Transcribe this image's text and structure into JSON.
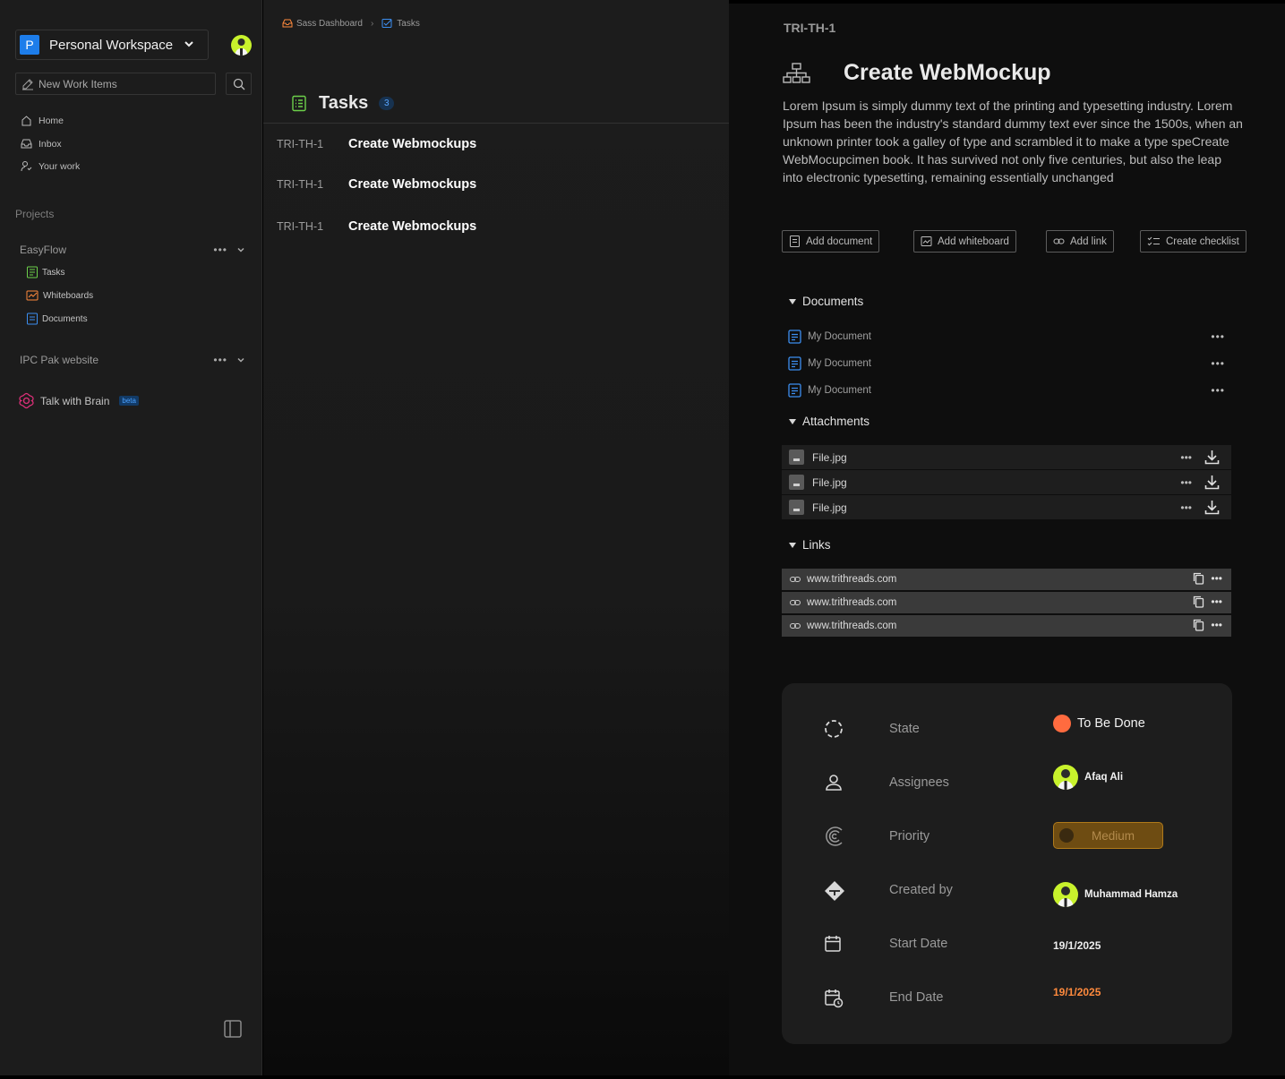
{
  "sidebar": {
    "workspace": {
      "badge": "P",
      "name": "Personal Workspace"
    },
    "new_items_label": "New Work Items",
    "nav": [
      {
        "label": "Home"
      },
      {
        "label": "Inbox"
      },
      {
        "label": "Your work"
      }
    ],
    "projects_title": "Projects",
    "projects": [
      {
        "name": "EasyFlow",
        "items": [
          {
            "label": "Tasks"
          },
          {
            "label": "Whiteboards"
          },
          {
            "label": "Documents"
          }
        ]
      },
      {
        "name": "IPC Pak website"
      }
    ],
    "brain": {
      "label": "Talk with Brain",
      "badge": "beta"
    }
  },
  "main": {
    "breadcrumb": [
      "Sass Dashboard",
      "Tasks"
    ],
    "title": "Tasks",
    "count": "3",
    "tasks": [
      {
        "id": "TRI-TH-1",
        "name": "Create Webmockups"
      },
      {
        "id": "TRI-TH-1",
        "name": "Create Webmockups"
      },
      {
        "id": "TRI-TH-1",
        "name": "Create Webmockups"
      }
    ]
  },
  "detail": {
    "id": "TRI-TH-1",
    "title": "Create WebMockup",
    "description": "Lorem Ipsum is simply dummy text of the printing and typesetting industry. Lorem Ipsum has been the industry's standard dummy text ever since the 1500s, when an unknown printer took a galley of type and scrambled it to make a type speCreate WebMocupcimen book. It has survived not only five centuries, but also the leap into electronic typesetting, remaining essentially unchanged",
    "actions": {
      "add_document": "Add document",
      "add_whiteboard": "Add whiteboard",
      "add_link": "Add link",
      "create_checklist": "Create checklist"
    },
    "documents_title": "Documents",
    "documents": [
      {
        "name": "My Document"
      },
      {
        "name": "My Document"
      },
      {
        "name": "My Document"
      }
    ],
    "attachments_title": "Attachments",
    "attachments": [
      {
        "name": "File.jpg"
      },
      {
        "name": "File.jpg"
      },
      {
        "name": "File.jpg"
      }
    ],
    "links_title": "Links",
    "links": [
      {
        "url": "www.trithreads.com"
      },
      {
        "url": "www.trithreads.com"
      },
      {
        "url": "www.trithreads.com"
      }
    ],
    "properties": {
      "state_label": "State",
      "state_value": "To  Be Done",
      "assignees_label": "Assignees",
      "assignee": "Afaq Ali",
      "priority_label": "Priority",
      "priority_value": "Medium",
      "created_by_label": "Created by",
      "created_by": "Muhammad Hamza",
      "start_label": "Start Date",
      "start_value": "19/1/2025",
      "end_label": "End Date",
      "end_value": "19/1/2025"
    }
  },
  "colors": {
    "accent": "#1d7dea",
    "state": "#ff6b3f",
    "end_date": "#ff8a3d",
    "priority": "#6e4c12",
    "avatar": "#c8f22c"
  }
}
